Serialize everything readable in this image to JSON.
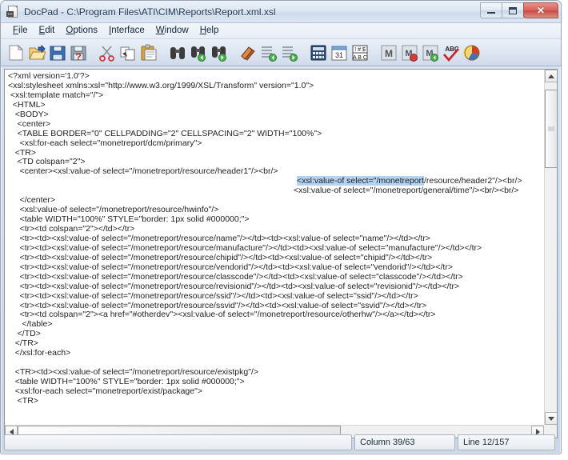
{
  "window": {
    "title": "DocPad - C:\\Program Files\\ATI\\CIM\\Reports\\Report.xml.xsl",
    "app_icon": "document-text-icon",
    "icon_label": "TXT",
    "minimize_label": "Minimize",
    "maximize_label": "Maximize",
    "close_label": "✕"
  },
  "menubar": {
    "items": [
      {
        "label": "File",
        "mnemonic": "F"
      },
      {
        "label": "Edit",
        "mnemonic": "E"
      },
      {
        "label": "Options",
        "mnemonic": "O"
      },
      {
        "label": "Interface",
        "mnemonic": "I"
      },
      {
        "label": "Window",
        "mnemonic": "W"
      },
      {
        "label": "Help",
        "mnemonic": "H"
      }
    ]
  },
  "toolbar": {
    "buttons": [
      {
        "name": "new-file-icon",
        "tooltip": "New"
      },
      {
        "name": "open-folder-icon",
        "tooltip": "Open"
      },
      {
        "name": "save-icon",
        "tooltip": "Save"
      },
      {
        "name": "save-as-icon",
        "tooltip": "Save As"
      },
      {
        "name": "cut-scissors-icon",
        "tooltip": "Cut"
      },
      {
        "name": "copy-icon",
        "tooltip": "Copy"
      },
      {
        "name": "paste-clipboard-icon",
        "tooltip": "Paste"
      },
      {
        "name": "find-binoculars-icon",
        "tooltip": "Find"
      },
      {
        "name": "find-next-icon",
        "tooltip": "Find Next"
      },
      {
        "name": "find-previous-icon",
        "tooltip": "Find Previous"
      },
      {
        "name": "eraser-icon",
        "tooltip": "Clear"
      },
      {
        "name": "sort-ascending-icon",
        "tooltip": "Sort Ascending"
      },
      {
        "name": "sort-descending-icon",
        "tooltip": "Sort Descending"
      },
      {
        "name": "calculator-icon",
        "tooltip": "Calculator"
      },
      {
        "name": "calendar-icon",
        "tooltip": "Calendar",
        "day": "31"
      },
      {
        "name": "character-map-icon",
        "tooltip": "Character Map",
        "top": "! # $",
        "bottom": "A B C"
      },
      {
        "name": "macro-icon",
        "tooltip": "Macro",
        "letter": "M"
      },
      {
        "name": "macro-record-icon",
        "tooltip": "Record Macro",
        "letter": "M"
      },
      {
        "name": "macro-play-icon",
        "tooltip": "Play Macro",
        "letter": "M"
      },
      {
        "name": "spellcheck-icon",
        "tooltip": "Spell Check",
        "letters": "ABC"
      },
      {
        "name": "color-palette-icon",
        "tooltip": "Colors"
      }
    ]
  },
  "editor": {
    "lines": [
      "<?xml version='1.0'?>",
      "<xsl:stylesheet xmlns:xsl=\"http://www.w3.org/1999/XSL/Transform\" version=\"1.0\">",
      " <xsl:template match=\"/\">",
      "  <HTML>",
      "   <BODY>",
      "    <center>",
      "    <TABLE BORDER=\"0\" CELLPADDING=\"2\" CELLSPACING=\"2\" WIDTH=\"100%\">",
      "     <xsl:for-each select=\"monetreport/dcm/primary\">",
      "   <TR>",
      "    <TD colspan=\"2\">",
      "     <center><xsl:value-of select=\"/monetreport/resource/header1\"/><br/>",
      "",
      "",
      "     </center>",
      "     <xsl:value-of select=\"/monetreport/resource/hwinfo\"/>",
      "     <table WIDTH=\"100%\" STYLE=\"border: 1px solid #000000;\">",
      "     <tr><td colspan=\"2\"></td></tr>",
      "     <tr><td><xsl:value-of select=\"/monetreport/resource/name\"/></td><td><xsl:value-of select=\"name\"/></td></tr>",
      "     <tr><td><xsl:value-of select=\"/monetreport/resource/manufacture\"/></td><td><xsl:value-of select=\"manufacture\"/></td></tr>",
      "     <tr><td><xsl:value-of select=\"/monetreport/resource/chipid\"/></td><td><xsl:value-of select=\"chipid\"/></td></tr>",
      "     <tr><td><xsl:value-of select=\"/monetreport/resource/vendorid\"/></td><td><xsl:value-of select=\"vendorid\"/></td></tr>",
      "     <tr><td><xsl:value-of select=\"/monetreport/resource/classcode\"/></td><td><xsl:value-of select=\"classcode\"/></td></tr>",
      "     <tr><td><xsl:value-of select=\"/monetreport/resource/revisionid\"/></td><td><xsl:value-of select=\"revisionid\"/></td></tr>",
      "     <tr><td><xsl:value-of select=\"/monetreport/resource/ssid\"/></td><td><xsl:value-of select=\"ssid\"/></td></tr>",
      "     <tr><td><xsl:value-of select=\"/monetreport/resource/ssvid\"/></td><td><xsl:value-of select=\"ssvid\"/></td></tr>",
      "     <tr><td colspan=\"2\"><a href=\"#otherdev\"><xsl:value-of select=\"/monetreport/resource/otherhw\"/></a></td></tr>",
      "      </table>",
      "    </TD>",
      "   </TR>",
      "   </xsl:for-each>",
      "",
      "   <TR><td><xsl:value-of select=\"/monetreport/resource/existpkg\"/>",
      "   <table WIDTH=\"100%\" STYLE=\"border: 1px solid #000000;\">",
      "   <xsl:for-each select=\"monetreport/exist/package\">",
      "    <TR>"
    ],
    "selection": {
      "line_index": 11,
      "selected_text": "<xsl:value-of select=\"/monetreport",
      "trailing_text": "/resource/header2\"/><br/>",
      "next_line_text": "<xsl:value-of select=\"/monetreport/general/time\"/><br/><br/>",
      "highlight_color": "#b4d2f2"
    }
  },
  "statusbar": {
    "main": "",
    "column": "Column 39/63",
    "line": "Line 12/157"
  },
  "scrollbars": {
    "vertical": {
      "name": "vertical-scrollbar",
      "thumb_top_pct": 2,
      "thumb_height_pct": 22
    },
    "horizontal": {
      "name": "horizontal-scrollbar",
      "thumb_left_pct": 0,
      "thumb_width_pct": 60
    }
  }
}
